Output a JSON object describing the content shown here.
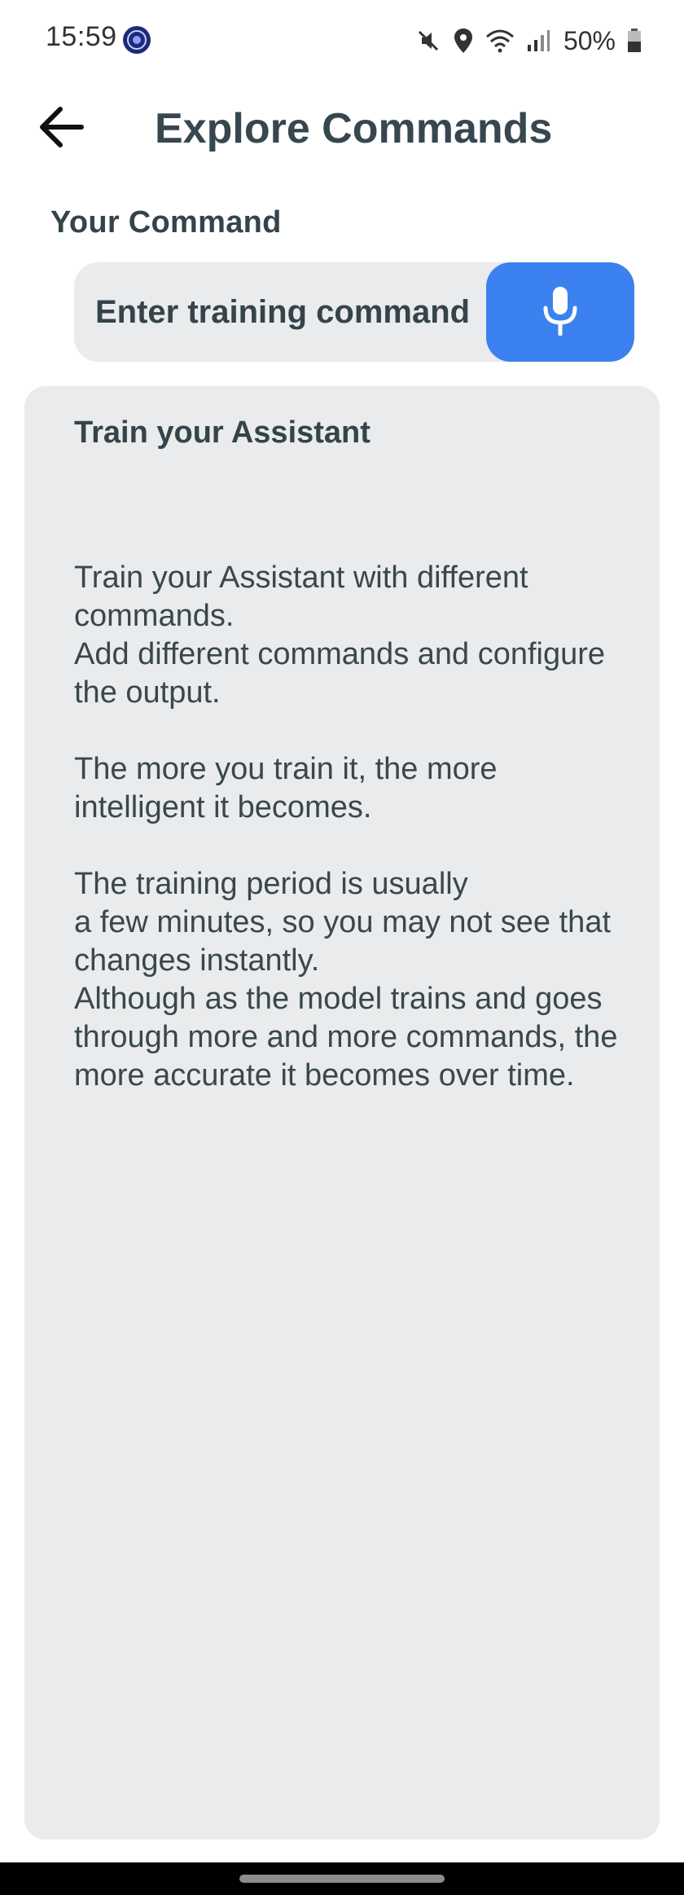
{
  "status_bar": {
    "time": "15:59",
    "battery": "50%",
    "icons": [
      "app-badge-icon",
      "mute-icon",
      "location-icon",
      "wifi-icon",
      "signal-icon",
      "battery-icon"
    ]
  },
  "header": {
    "title": "Explore Commands",
    "back_icon": "arrow-left-icon"
  },
  "command": {
    "label": "Your Command",
    "placeholder": "Enter training command",
    "value": "",
    "mic_icon": "microphone-icon"
  },
  "card": {
    "title": "Train your Assistant",
    "paragraphs": [
      "Train your Assistant with different commands.\nAdd different commands and configure the output.",
      "The more you train it, the more intelligent it becomes.",
      "The training period is usually\na few minutes, so you may not see that changes instantly.\nAlthough as the model trains and goes through more and more commands, the more accurate it becomes over time."
    ]
  },
  "colors": {
    "accent": "#3b82f0",
    "field_bg": "#e9ebec",
    "text": "#35434a"
  }
}
